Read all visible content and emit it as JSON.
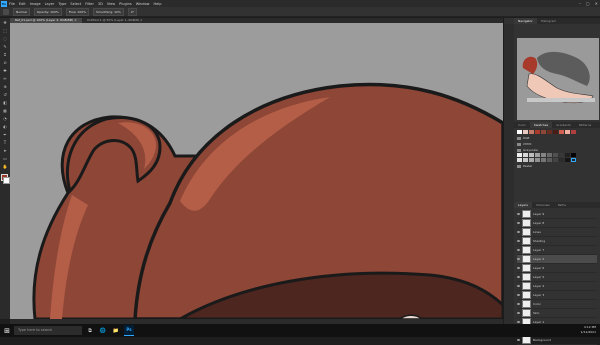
{
  "menu": {
    "logo": "Ps",
    "items": [
      "File",
      "Edit",
      "Image",
      "Layer",
      "Type",
      "Select",
      "Filter",
      "3D",
      "View",
      "Plugins",
      "Window",
      "Help"
    ],
    "window_controls": [
      "–",
      "▢",
      "✕"
    ]
  },
  "options": {
    "mode_label": "Normal",
    "opacity_label": "Opacity: 100%",
    "flow_label": "Flow: 100%",
    "smoothing_label": "Smoothing: 10%",
    "angle_label": "0°"
  },
  "tabs": [
    {
      "label": "Ref_01.psd @ 100% (Layer 2, RGB/8#) ×",
      "active": true
    },
    {
      "label": "Untitled-1 @ 50% (Layer 1, RGB/8) ×",
      "active": false
    }
  ],
  "panel": {
    "top_tabs": [
      "Navigator",
      "Histogram"
    ],
    "swatch_tabs": [
      "Color",
      "Swatches",
      "Gradients",
      "Patterns"
    ],
    "groups": [
      "RGB",
      "CMYK",
      "Grayscale",
      "Pastel"
    ],
    "layer_tabs": [
      "Layers",
      "Channels",
      "Paths"
    ],
    "layers": [
      "Layer 9",
      "Layer 8",
      "Lines",
      "Shading",
      "Layer 7",
      "Layer 2",
      "Layer 6",
      "Layer 5",
      "Layer 4",
      "Layer 3",
      "Color",
      "Skin",
      "Layer 1",
      "Sketch",
      "Background"
    ],
    "selected_index": 5
  },
  "taskbar": {
    "search_placeholder": "Type here to search",
    "apps": [
      "⧉",
      "🌐",
      "📁",
      "Ps"
    ],
    "time": "4:12 PM",
    "date": "1/11/2021"
  },
  "colors": {
    "canvas_bg": "#9c9c9c",
    "skin": "#8e4636",
    "highlight": "#b45e48",
    "outline": "#1a1a1a",
    "accent": "#31a8ff"
  }
}
